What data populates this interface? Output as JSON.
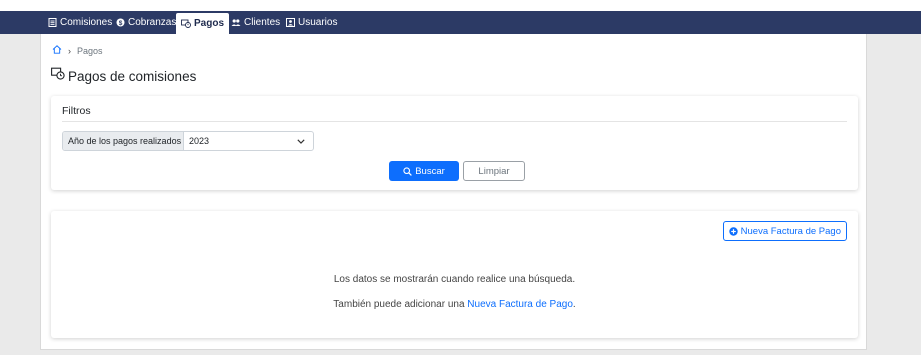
{
  "nav": {
    "items": [
      {
        "label": "Comisiones",
        "icon": "document-list-icon"
      },
      {
        "label": "Cobranzas",
        "icon": "dollar-circle-icon"
      },
      {
        "label": "Pagos",
        "icon": "payment-clock-icon",
        "active": true
      },
      {
        "label": "Clientes",
        "icon": "people-icon"
      },
      {
        "label": "Usuarios",
        "icon": "user-card-icon"
      }
    ]
  },
  "breadcrumb": {
    "current": "Pagos"
  },
  "page": {
    "title": "Pagos de comisiones"
  },
  "filters": {
    "title": "Filtros",
    "year_label": "Año de los pagos realizados",
    "year_value": "2023",
    "search_label": "Buscar",
    "clear_label": "Limpiar"
  },
  "results": {
    "new_invoice_label": "Nueva Factura de Pago",
    "empty_message": "Los datos se mostrarán cuando realice una búsqueda.",
    "add_prefix": "También puede adicionar una ",
    "add_link": "Nueva Factura de Pago",
    "add_suffix": "."
  },
  "colors": {
    "navbar": "#2c3a65",
    "primary": "#0d6efd"
  }
}
